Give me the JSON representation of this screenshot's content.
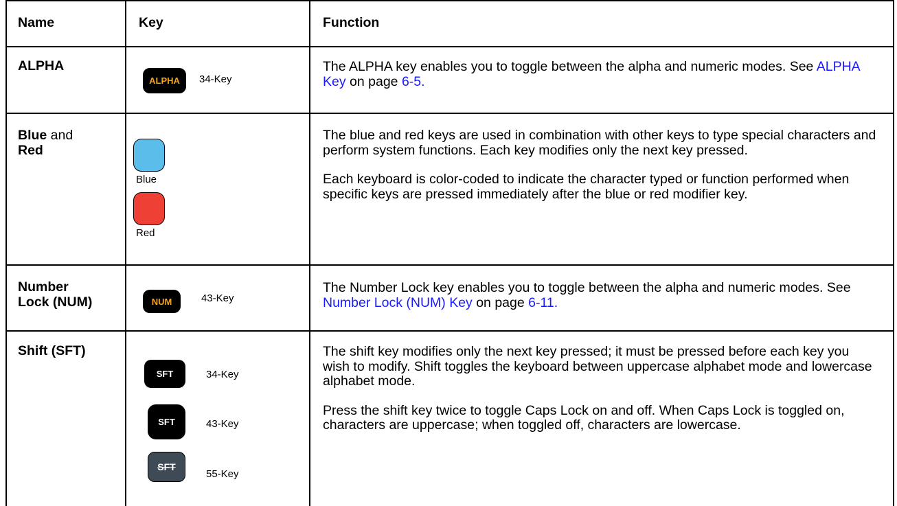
{
  "table": {
    "headers": {
      "name": "Name",
      "key": "Key",
      "function": "Function"
    },
    "rows": [
      {
        "name": "ALPHA",
        "keys": [
          {
            "label": "ALPHA",
            "caption": "34-Key"
          }
        ],
        "function": [
          {
            "pre": "The ALPHA key enables you to toggle between the alpha and numeric modes. See ",
            "link": "ALPHA Key",
            "mid": " on page ",
            "page": "6-5."
          }
        ]
      },
      {
        "name_bold": "Blue",
        "name_and": " and",
        "name_line2": "Red",
        "keys": [
          {
            "caption": "Blue",
            "color": "#5bbdea"
          },
          {
            "caption": "Red",
            "color": "#ef4035"
          }
        ],
        "function": [
          "The blue and red keys are used in combination with other keys to type special characters and perform system functions. Each key modifies only the next key pressed.",
          "Each keyboard is color-coded to indicate the character typed or function performed when specific keys are pressed immediately after the blue or red modifier key."
        ]
      },
      {
        "name_line1": "Number",
        "name_line2": "Lock (NUM)",
        "keys": [
          {
            "label": "NUM",
            "caption": "43-Key"
          }
        ],
        "function": [
          {
            "pre": "The Number Lock key enables you to toggle between the alpha and numeric modes. See ",
            "link": "Number Lock (NUM) Key",
            "mid": " on page ",
            "page": "6-11."
          }
        ]
      },
      {
        "name": "Shift (SFT)",
        "keys": [
          {
            "label": "SFT",
            "caption": "34-Key"
          },
          {
            "label": "SFT",
            "caption": "43-Key"
          },
          {
            "label": "SFT",
            "caption": "55-Key"
          }
        ],
        "function": [
          "The shift key modifies only the next key pressed; it must be pressed before each key you wish to modify. Shift toggles the keyboard between uppercase alphabet mode and lowercase alphabet mode.",
          "Press the shift key twice to toggle Caps Lock on and off. When Caps Lock is toggled on, characters are uppercase; when toggled off, characters are lowercase."
        ]
      }
    ]
  },
  "colors": {
    "key_orange": "#f5a31a",
    "link_blue": "#1a1aff",
    "key_55_gray": "#3e4a55"
  }
}
